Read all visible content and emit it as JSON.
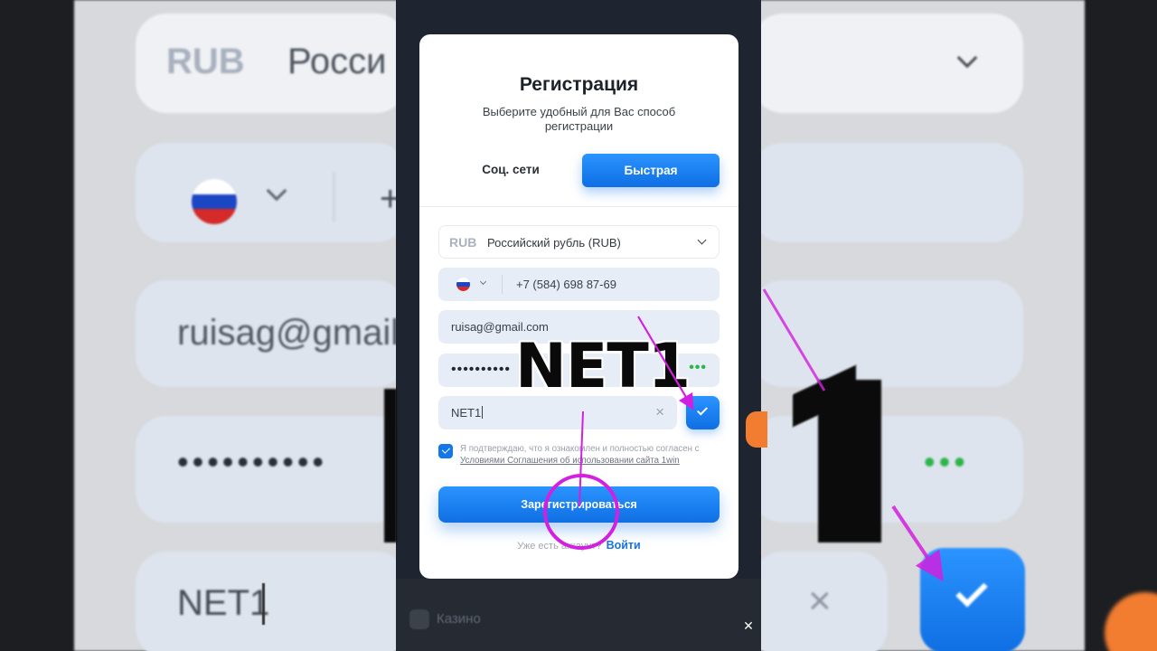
{
  "modal": {
    "title": "Регистрация",
    "subtitle": "Выберите удобный для Вас способ регистрации",
    "tabs": {
      "social": "Соц. сети",
      "fast": "Быстрая"
    },
    "currency": {
      "code": "RUB",
      "name": "Российский рубль (RUB)"
    },
    "phone": {
      "value": "+7 (584) 698 87-69"
    },
    "email": {
      "value": "ruisag@gmail.com"
    },
    "password": {
      "masked": "••••••••••",
      "indicator": "•••"
    },
    "promo": {
      "value": "NET1",
      "clear_symbol": "×"
    },
    "consent": {
      "text_before": "Я подтверждаю, что я ознакомлен и полностью согласен с ",
      "link": "Условиями Соглашения об использовании сайта 1win"
    },
    "register_button": "Зарегистрироваться",
    "login_prompt": "Уже есть аккаунт?",
    "login_link": "Войти"
  },
  "overlay": {
    "caption": "NET1",
    "close_symbol": "✕"
  },
  "background": {
    "currency_code": "RUB",
    "currency_name": "Росси",
    "phone_prefix": "+",
    "email": "ruisag@gmail",
    "promo": "NET1",
    "dots": "••••••••••",
    "indicator": "•••",
    "casino_label": "Казино"
  },
  "colors": {
    "accent": "#1576e9",
    "success": "#2db44a",
    "annotation": "#d31fe0"
  }
}
